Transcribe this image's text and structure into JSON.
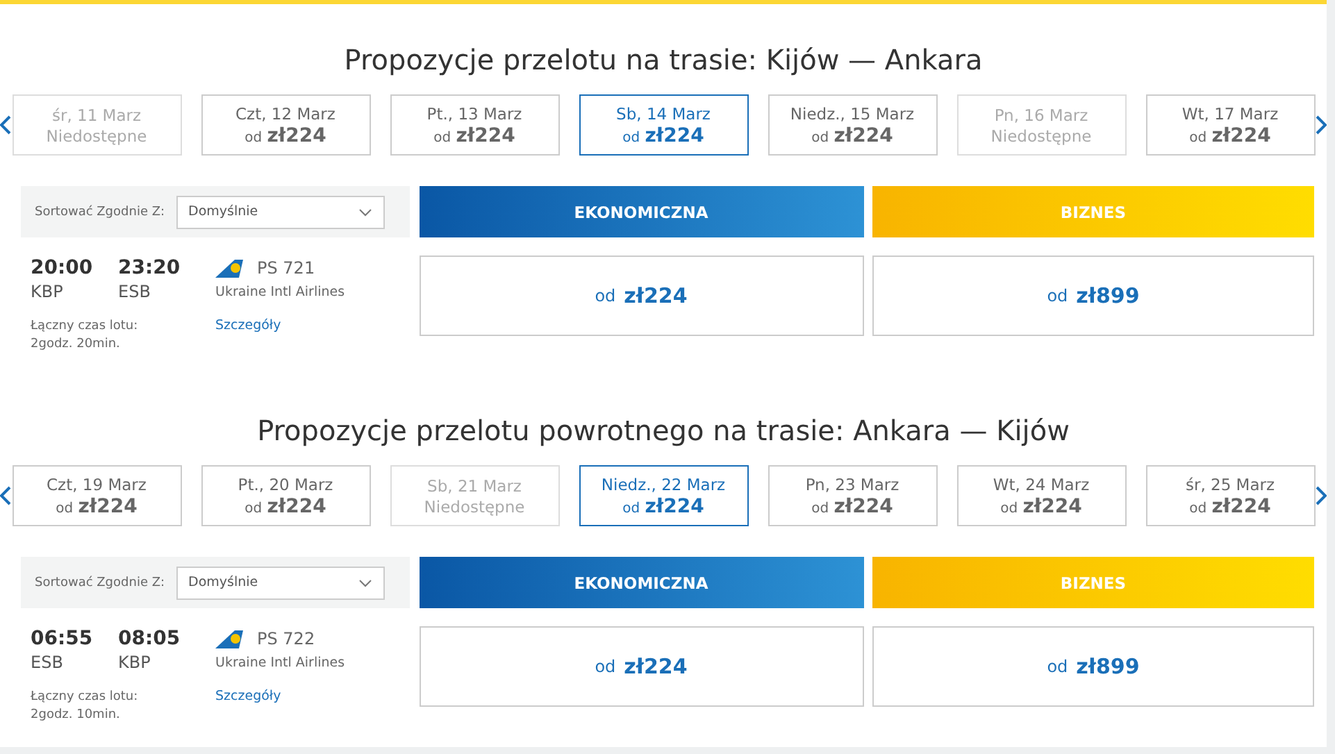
{
  "sections": [
    {
      "title": "Propozycje przelotu na trasie: Kijów — Ankara",
      "dates": [
        {
          "kind": "unavailable",
          "label": "śr, 11 Marz",
          "status": "Niedostępne",
          "selected": false
        },
        {
          "kind": "available",
          "label": "Czt, 12 Marz",
          "prefix": "od",
          "price": "zł224",
          "selected": false
        },
        {
          "kind": "available",
          "label": "Pt., 13 Marz",
          "prefix": "od",
          "price": "zł224",
          "selected": false
        },
        {
          "kind": "available",
          "label": "Sb, 14 Marz",
          "prefix": "od",
          "price": "zł224",
          "selected": true
        },
        {
          "kind": "available",
          "label": "Niedz., 15 Marz",
          "prefix": "od",
          "price": "zł224",
          "selected": false
        },
        {
          "kind": "unavailable",
          "label": "Pn, 16 Marz",
          "status": "Niedostępne",
          "selected": false
        },
        {
          "kind": "available",
          "label": "Wt, 17 Marz",
          "prefix": "od",
          "price": "zł224",
          "selected": false
        }
      ],
      "sort": {
        "label": "Sortować Zgodnie Z:",
        "value": "Domyślnie"
      },
      "fares": [
        {
          "kind": "economy",
          "label": "EKONOMICZNA"
        },
        {
          "kind": "business",
          "label": "BIZNES"
        }
      ],
      "flight": {
        "depart_time": "20:00",
        "depart_airport": "KBP",
        "arrive_time": "23:20",
        "arrive_airport": "ESB",
        "duration_label": "Łączny czas lotu:",
        "duration": "2godz. 20min.",
        "flight_number": "PS 721",
        "airline": "Ukraine Intl Airlines",
        "details_link": "Szczegóły",
        "prices": [
          {
            "prefix": "od",
            "price": "zł224"
          },
          {
            "prefix": "od",
            "price": "zł899"
          }
        ]
      }
    },
    {
      "title": "Propozycje przelotu powrotnego na trasie: Ankara — Kijów",
      "dates": [
        {
          "kind": "available",
          "label": "Czt, 19 Marz",
          "prefix": "od",
          "price": "zł224",
          "selected": false
        },
        {
          "kind": "available",
          "label": "Pt., 20 Marz",
          "prefix": "od",
          "price": "zł224",
          "selected": false
        },
        {
          "kind": "unavailable",
          "label": "Sb, 21 Marz",
          "status": "Niedostępne",
          "selected": false
        },
        {
          "kind": "available",
          "label": "Niedz., 22 Marz",
          "prefix": "od",
          "price": "zł224",
          "selected": true
        },
        {
          "kind": "available",
          "label": "Pn, 23 Marz",
          "prefix": "od",
          "price": "zł224",
          "selected": false
        },
        {
          "kind": "available",
          "label": "Wt, 24 Marz",
          "prefix": "od",
          "price": "zł224",
          "selected": false
        },
        {
          "kind": "available",
          "label": "śr, 25 Marz",
          "prefix": "od",
          "price": "zł224",
          "selected": false
        }
      ],
      "sort": {
        "label": "Sortować Zgodnie Z:",
        "value": "Domyślnie"
      },
      "fares": [
        {
          "kind": "economy",
          "label": "EKONOMICZNA"
        },
        {
          "kind": "business",
          "label": "BIZNES"
        }
      ],
      "flight": {
        "depart_time": "06:55",
        "depart_airport": "ESB",
        "arrive_time": "08:05",
        "arrive_airport": "KBP",
        "duration_label": "Łączny czas lotu:",
        "duration": "2godz. 10min.",
        "flight_number": "PS 722",
        "airline": "Ukraine Intl Airlines",
        "details_link": "Szczegóły",
        "prices": [
          {
            "prefix": "od",
            "price": "zł224"
          },
          {
            "prefix": "od",
            "price": "zł899"
          }
        ]
      }
    }
  ]
}
